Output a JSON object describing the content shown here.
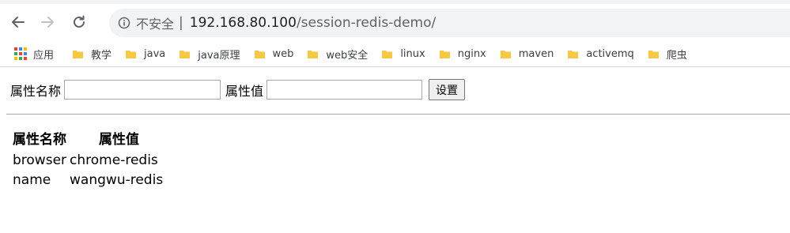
{
  "browser": {
    "security_label": "不安全",
    "separator": "|",
    "url_host": "192.168.80.100",
    "url_path": "/session-redis-demo/"
  },
  "bookmarks": {
    "apps_label": "应用",
    "items": [
      {
        "label": "教学"
      },
      {
        "label": "java"
      },
      {
        "label": "java原理"
      },
      {
        "label": "web"
      },
      {
        "label": "web安全"
      },
      {
        "label": "linux"
      },
      {
        "label": "nginx"
      },
      {
        "label": "maven"
      },
      {
        "label": "activemq"
      },
      {
        "label": "爬虫"
      }
    ],
    "folder_color": "#f7c843",
    "apps_colors": [
      "#ea4335",
      "#4285f4",
      "#fbbc05",
      "#34a853",
      "#ea4335",
      "#4285f4",
      "#fbbc05",
      "#34a853",
      "#ea4335"
    ]
  },
  "form": {
    "name_label": "属性名称",
    "name_value": "",
    "value_label": "属性值",
    "value_value": "",
    "submit_label": "设置"
  },
  "table": {
    "headers": [
      "属性名称",
      "属性值"
    ],
    "rows": [
      [
        "browser",
        "chrome-redis"
      ],
      [
        "name",
        "wangwu-redis"
      ]
    ]
  }
}
